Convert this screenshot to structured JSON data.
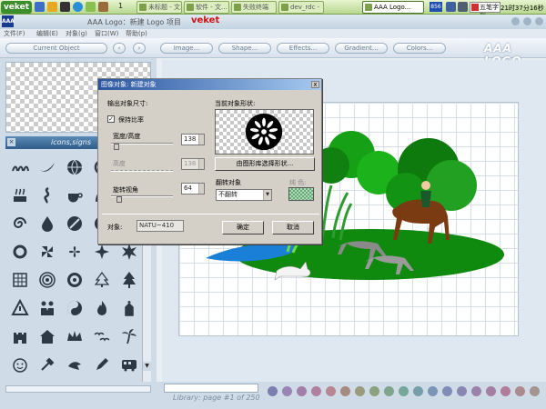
{
  "taskbar": {
    "start_label": "veket",
    "workspace_number": "1",
    "tasks": [
      {
        "label": "未标题 - 文..."
      },
      {
        "label": "软件 - 文..."
      },
      {
        "label": "失败终端"
      },
      {
        "label": "dev_rdc -"
      },
      {
        "label": "AAA Logo..."
      }
    ],
    "cpu": "856",
    "ime_label": "五笔字型",
    "clock": "21时37分16秒"
  },
  "app": {
    "icon_label": "AAA",
    "title": "AAA Logo：新建 Logo 项目",
    "brand": "veket"
  },
  "menu": [
    {
      "label": "文件(F)"
    },
    {
      "label": "编辑(E)"
    },
    {
      "label": "对象(g)"
    },
    {
      "label": "窗口(W)"
    },
    {
      "label": "帮助(p)"
    }
  ],
  "toolbar": {
    "current_object": "Current Object",
    "prev": "‹",
    "next": "›",
    "image": "Image...",
    "shape": "Shape...",
    "effects": "Effects...",
    "gradient": "Gradient...",
    "colors": "Colors...",
    "logo_word": "AAA LOGO"
  },
  "library": {
    "title": "icons,signs",
    "close": "×",
    "status": "Library: page #1 of 250",
    "scroll_up": "▲",
    "scroll_down": "▼"
  },
  "dialog": {
    "title": "图像对象: 新建对象",
    "close": "x",
    "output_size_label": "输出对象尺寸:",
    "keep_ratio_label": "保持比率",
    "keep_ratio_checked": "✓",
    "width_height_label": "宽度/高度",
    "width_height_value": "138",
    "height_label": "高度",
    "height_value": "138",
    "rotation_label": "旋转视角",
    "rotation_value": "64",
    "current_shape_label": "当前对象形状:",
    "choose_shape_button": "由图形库选择形状...",
    "flip_label": "翻转对象",
    "flip_value": "不翻转",
    "color_label": "纯 色:",
    "object_label": "对象:",
    "object_value": "NATU~410",
    "ok": "确定",
    "cancel": "取消"
  }
}
